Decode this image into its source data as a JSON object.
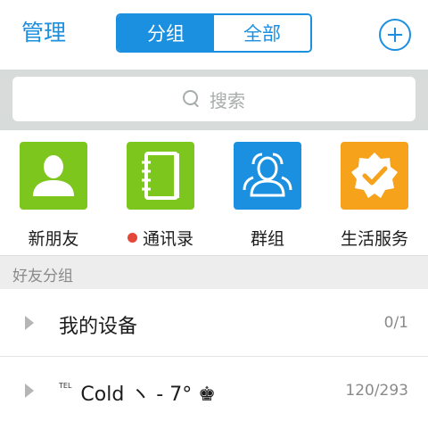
{
  "header": {
    "manage_label": "管理",
    "tabs": [
      {
        "label": "分组",
        "active": true
      },
      {
        "label": "全部",
        "active": false
      }
    ]
  },
  "search": {
    "placeholder": "搜索"
  },
  "shortcuts": [
    {
      "label": "新朋友",
      "icon": "person-icon",
      "color": "#7dc61e"
    },
    {
      "label": "通讯录",
      "icon": "address-book-icon",
      "color": "#7dc61e",
      "badge": "red-dot"
    },
    {
      "label": "群组",
      "icon": "group-icon",
      "color": "#1b8fe0"
    },
    {
      "label": "生活服务",
      "icon": "badge-check-icon",
      "color": "#f7a21b"
    }
  ],
  "group_section": {
    "title": "好友分组"
  },
  "groups": [
    {
      "name": "我的设备",
      "count": "0/1"
    },
    {
      "name_prefix": "TEL",
      "name": "Cold ヽ - 7° ♚",
      "count": "120/293"
    }
  ],
  "colors": {
    "accent": "#1b8fe0",
    "green": "#7dc61e",
    "orange": "#f7a21b",
    "red_dot": "#e5463a"
  }
}
